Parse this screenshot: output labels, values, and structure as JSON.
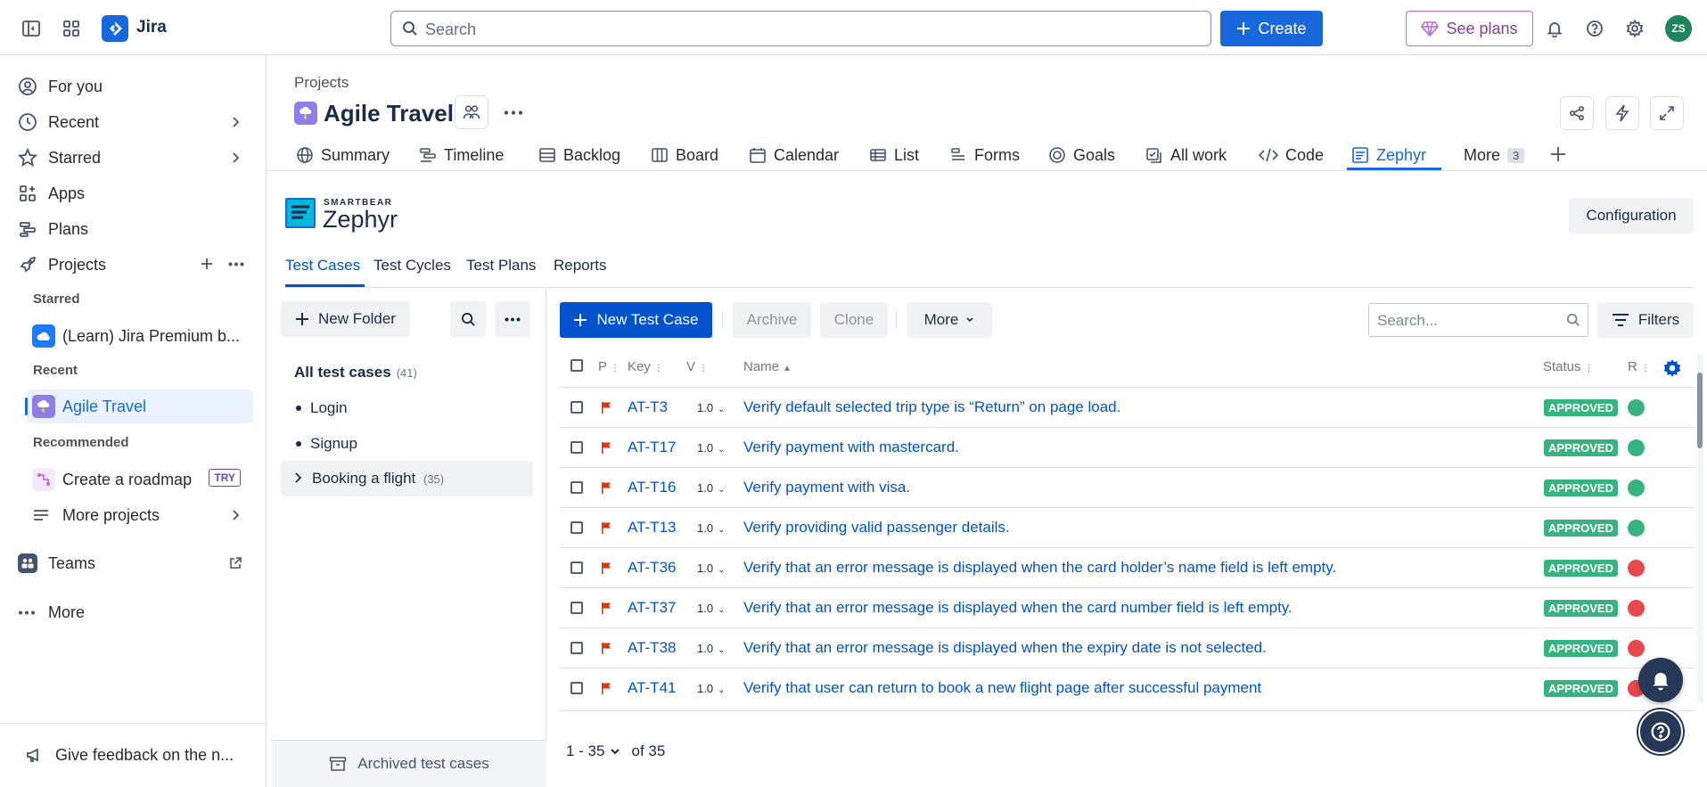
{
  "topbar": {
    "app_name": "Jira",
    "search_placeholder": "Search",
    "create_label": "Create",
    "plans_label": "See plans",
    "avatar_initials": "ZS"
  },
  "sidebar": {
    "for_you": "For you",
    "recent": "Recent",
    "starred": "Starred",
    "apps": "Apps",
    "plans": "Plans",
    "projects": "Projects",
    "starred_header": "Starred",
    "starred_project": "(Learn) Jira Premium b...",
    "recent_header": "Recent",
    "recent_project": "Agile Travel",
    "recommended_header": "Recommended",
    "roadmap": "Create a roadmap",
    "try_badge": "TRY",
    "more_projects": "More projects",
    "teams": "Teams",
    "more": "More",
    "feedback": "Give feedback on the n..."
  },
  "project": {
    "breadcrumb": "Projects",
    "title": "Agile Travel",
    "tabs": {
      "summary": "Summary",
      "timeline": "Timeline",
      "backlog": "Backlog",
      "board": "Board",
      "calendar": "Calendar",
      "list": "List",
      "forms": "Forms",
      "goals": "Goals",
      "all_work": "All work",
      "code": "Code",
      "zephyr": "Zephyr",
      "more": "More",
      "more_count": "3"
    }
  },
  "zephyr": {
    "brand_small": "SMARTBEAR",
    "brand_large": "Zephyr",
    "configuration": "Configuration",
    "tabs": {
      "test_cases": "Test Cases",
      "test_cycles": "Test Cycles",
      "test_plans": "Test Plans",
      "reports": "Reports"
    },
    "new_folder": "New Folder",
    "folders": {
      "all_label": "All test cases",
      "all_count": "(41)",
      "login": "Login",
      "signup": "Signup",
      "booking": "Booking a flight",
      "booking_count": "(35)"
    },
    "archived": "Archived test cases",
    "toolbar": {
      "new_test_case": "New Test Case",
      "archive": "Archive",
      "clone": "Clone",
      "more": "More",
      "search_placeholder": "Search...",
      "filters": "Filters"
    },
    "columns": {
      "p": "P",
      "key": "Key",
      "v": "V",
      "name": "Name",
      "status": "Status",
      "r": "R"
    },
    "rows": [
      {
        "key": "AT-T3",
        "version": "1.0",
        "name": "Verify default selected trip type is “Return” on page load.",
        "status": "APPROVED",
        "result": "pass"
      },
      {
        "key": "AT-T17",
        "version": "1.0",
        "name": "Verify payment with mastercard.",
        "status": "APPROVED",
        "result": "pass"
      },
      {
        "key": "AT-T16",
        "version": "1.0",
        "name": "Verify payment with visa.",
        "status": "APPROVED",
        "result": "pass"
      },
      {
        "key": "AT-T13",
        "version": "1.0",
        "name": "Verify providing valid passenger details.",
        "status": "APPROVED",
        "result": "pass"
      },
      {
        "key": "AT-T36",
        "version": "1.0",
        "name": "Verify that an error message is displayed when the card holder’s name field is left empty.",
        "status": "APPROVED",
        "result": "fail"
      },
      {
        "key": "AT-T37",
        "version": "1.0",
        "name": "Verify that an error message is displayed when the card number field is left empty.",
        "status": "APPROVED",
        "result": "fail"
      },
      {
        "key": "AT-T38",
        "version": "1.0",
        "name": "Verify that an error message is displayed when the expiry date is not selected.",
        "status": "APPROVED",
        "result": "fail"
      },
      {
        "key": "AT-T41",
        "version": "1.0",
        "name": "Verify that user can return to book a new flight page after successful payment",
        "status": "APPROVED",
        "result": "fail"
      }
    ],
    "pagination": {
      "range": "1 - 35",
      "of": "of 35"
    }
  },
  "colors": {
    "primary": "#1868db",
    "link": "#0052cc",
    "approved": "#36b37e",
    "pass": "#36b37e",
    "fail": "#e5484d",
    "flag": "#de350b"
  }
}
